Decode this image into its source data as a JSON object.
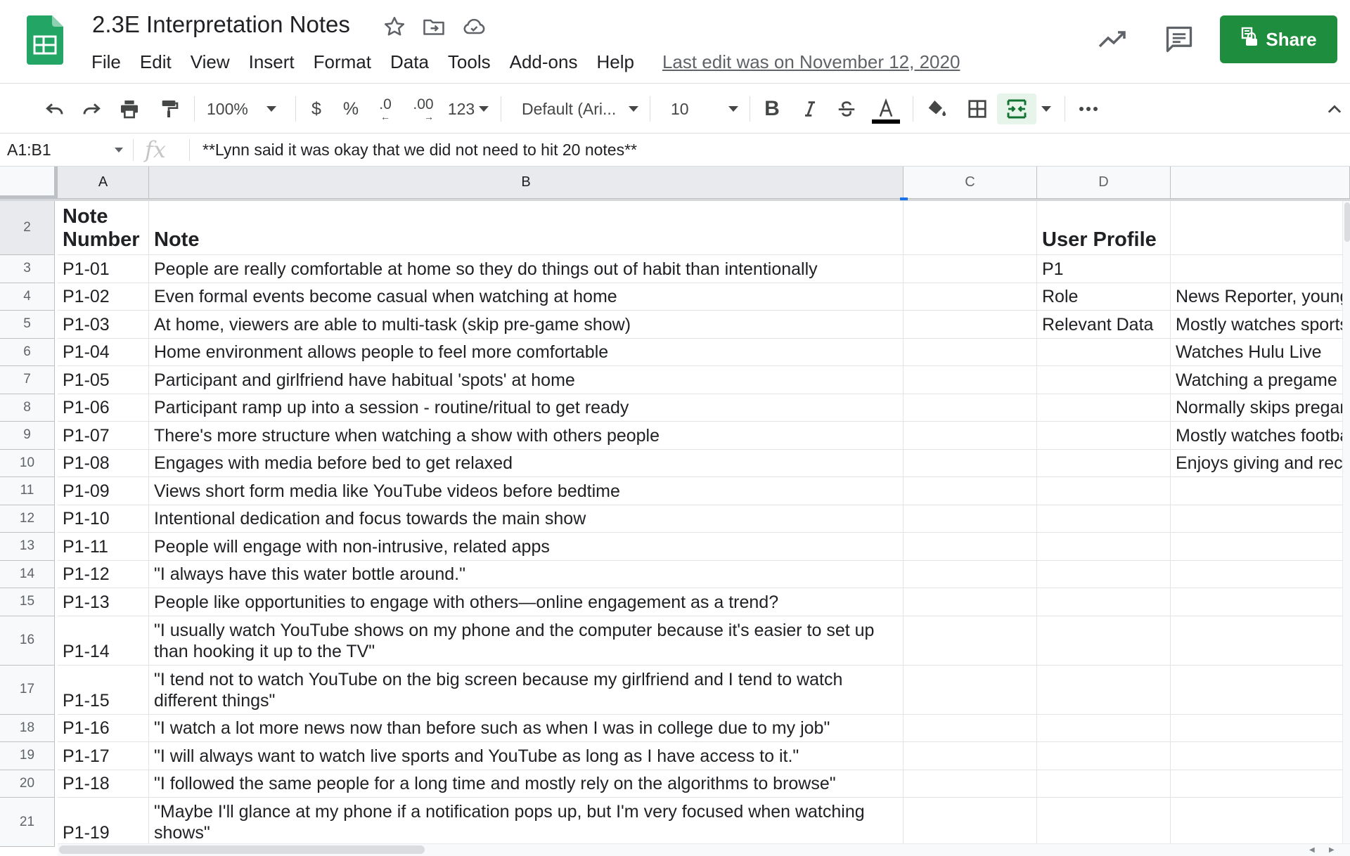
{
  "header": {
    "title": "2.3E Interpretation Notes",
    "menu": [
      "File",
      "Edit",
      "View",
      "Insert",
      "Format",
      "Data",
      "Tools",
      "Add-ons",
      "Help"
    ],
    "last_edit": "Last edit was on November 12, 2020",
    "share_label": "Share",
    "brand_color": "#1e8e3e"
  },
  "toolbar": {
    "zoom": "100%",
    "currency": "$",
    "percent": "%",
    "decrease_decimal": ".0",
    "increase_decimal": ".00",
    "more_formats": "123",
    "font": "Default (Ari...",
    "font_size": "10",
    "icons": [
      "undo-icon",
      "redo-icon",
      "print-icon",
      "paint-format-icon",
      "bold-icon",
      "italic-icon",
      "strikethrough-icon",
      "text-color-icon",
      "fill-color-icon",
      "borders-icon",
      "merge-cells-icon",
      "more-icon",
      "collapse-icon"
    ]
  },
  "formula_bar": {
    "name_box": "A1:B1",
    "fx": "fx",
    "content": "**Lynn said it was okay that we did not need to hit 20 notes**"
  },
  "grid": {
    "columns": [
      "A",
      "B",
      "C",
      "D",
      ""
    ],
    "rows": [
      {
        "num": "2",
        "a": "Note Number",
        "b": "Note",
        "d": "User Profile",
        "e": "",
        "header": true
      },
      {
        "num": "3",
        "a": "P1-01",
        "b": "People are really comfortable at home so they do things out of habit than intentionally",
        "d": "P1",
        "e": ""
      },
      {
        "num": "4",
        "a": "P1-02",
        "b": "Even formal events become casual when watching at home",
        "d": "Role",
        "e": "News Reporter, young"
      },
      {
        "num": "5",
        "a": "P1-03",
        "b": "At home, viewers are able to multi-task (skip pre-game show)",
        "d": "Relevant Data",
        "e": "Mostly watches sports"
      },
      {
        "num": "6",
        "a": "P1-04",
        "b": "Home environment allows people to feel more comfortable",
        "d": "",
        "e": "Watches Hulu Live"
      },
      {
        "num": "7",
        "a": "P1-05",
        "b": "Participant and girlfriend have habitual 'spots' at home",
        "d": "",
        "e": "Watching a pregame"
      },
      {
        "num": "8",
        "a": "P1-06",
        "b": "Participant ramp up into a session - routine/ritual to get ready",
        "d": "",
        "e": "Normally skips pregame"
      },
      {
        "num": "9",
        "a": "P1-07",
        "b": "There's more structure when watching a show with others people",
        "d": "",
        "e": "Mostly watches football"
      },
      {
        "num": "10",
        "a": "P1-08",
        "b": "Engages with media before bed to get relaxed",
        "d": "",
        "e": "Enjoys giving and rec"
      },
      {
        "num": "11",
        "a": "P1-09",
        "b": "Views short form media like YouTube videos before bedtime",
        "d": "",
        "e": ""
      },
      {
        "num": "12",
        "a": "P1-10",
        "b": "Intentional dedication and focus towards the main show",
        "d": "",
        "e": ""
      },
      {
        "num": "13",
        "a": "P1-11",
        "b": "People will engage with non-intrusive, related apps",
        "d": "",
        "e": ""
      },
      {
        "num": "14",
        "a": "P1-12",
        "b": "\"I always have this water bottle around.\"",
        "d": "",
        "e": ""
      },
      {
        "num": "15",
        "a": "P1-13",
        "b": "People like opportunities to engage with others—online engagement as a trend?",
        "d": "",
        "e": ""
      },
      {
        "num": "16",
        "a": "P1-14",
        "b": "\"I usually watch YouTube shows on my phone and the computer because it's easier to set up than hooking it up to the TV\"",
        "d": "",
        "e": "",
        "tall": true
      },
      {
        "num": "17",
        "a": "P1-15",
        "b": "\"I tend not to watch YouTube on the big screen because my girlfriend and I tend to watch different things\"",
        "d": "",
        "e": "",
        "tall": true
      },
      {
        "num": "18",
        "a": "P1-16",
        "b": "\"I watch a lot more news now than before such as when I was in college due to my job\"",
        "d": "",
        "e": ""
      },
      {
        "num": "19",
        "a": "P1-17",
        "b": "\"I will always want to watch live sports and YouTube as long as I have access to it.\"",
        "d": "",
        "e": ""
      },
      {
        "num": "20",
        "a": "P1-18",
        "b": "\"I followed the same people for a long time and mostly rely on the algorithms to browse\"",
        "d": "",
        "e": ""
      },
      {
        "num": "21",
        "a": "P1-19",
        "b": "\"Maybe I'll glance at my phone if a notification pops up, but I'm very focused when watching shows\"",
        "d": "",
        "e": "",
        "tall": true
      }
    ]
  }
}
